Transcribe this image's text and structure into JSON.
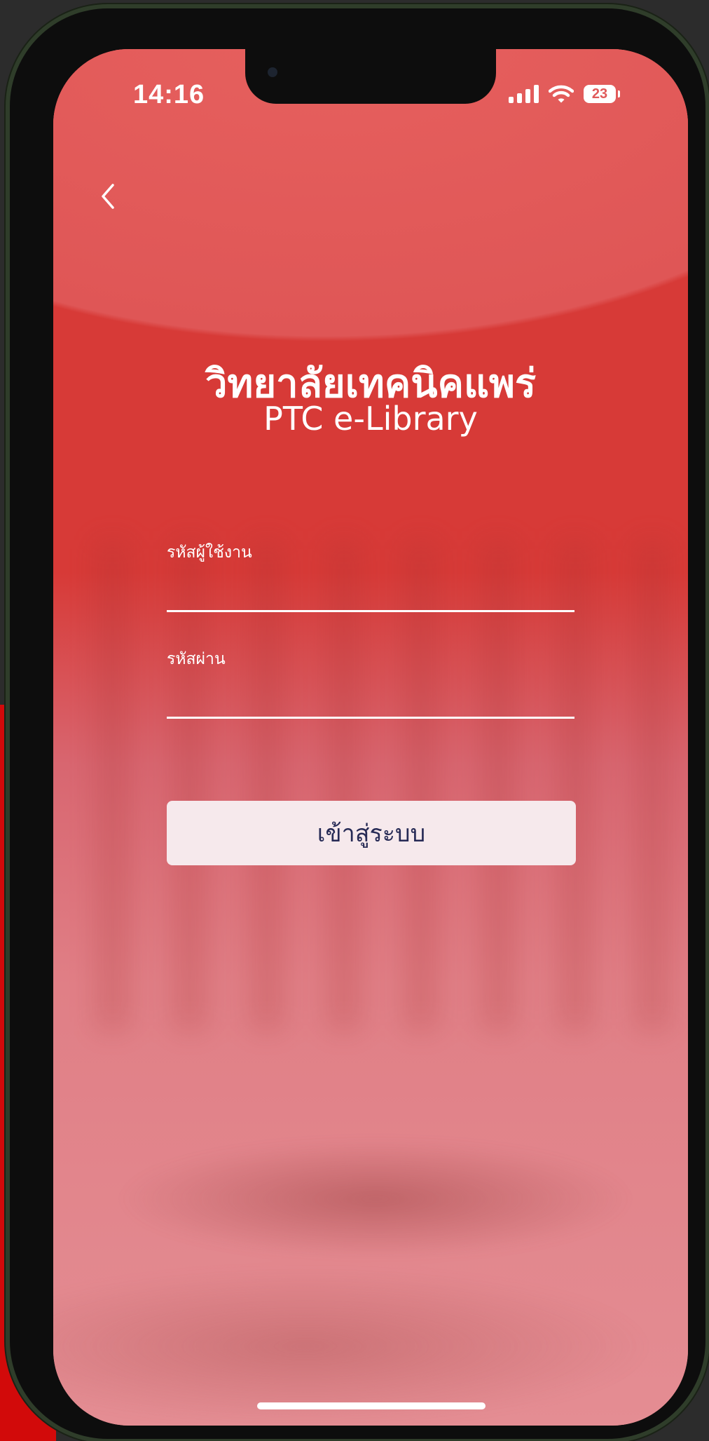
{
  "status_bar": {
    "time": "14:16",
    "battery": "23",
    "signal_icon": "cellular-signal-icon",
    "wifi_icon": "wifi-icon"
  },
  "header": {
    "back_icon": "chevron-left-icon"
  },
  "branding": {
    "title_thai": "วิทยาลัยเทคนิคแพร่",
    "title_en": "PTC e-Library"
  },
  "login_form": {
    "username_label": "รหัสผู้ใช้งาน",
    "username_value": "",
    "password_label": "รหัสผ่าน",
    "password_value": "",
    "submit_label": "เข้าสู่ระบบ"
  },
  "colors": {
    "primary_red": "#d73a37",
    "button_bg": "#f6e9ec",
    "button_text": "#262a55"
  }
}
